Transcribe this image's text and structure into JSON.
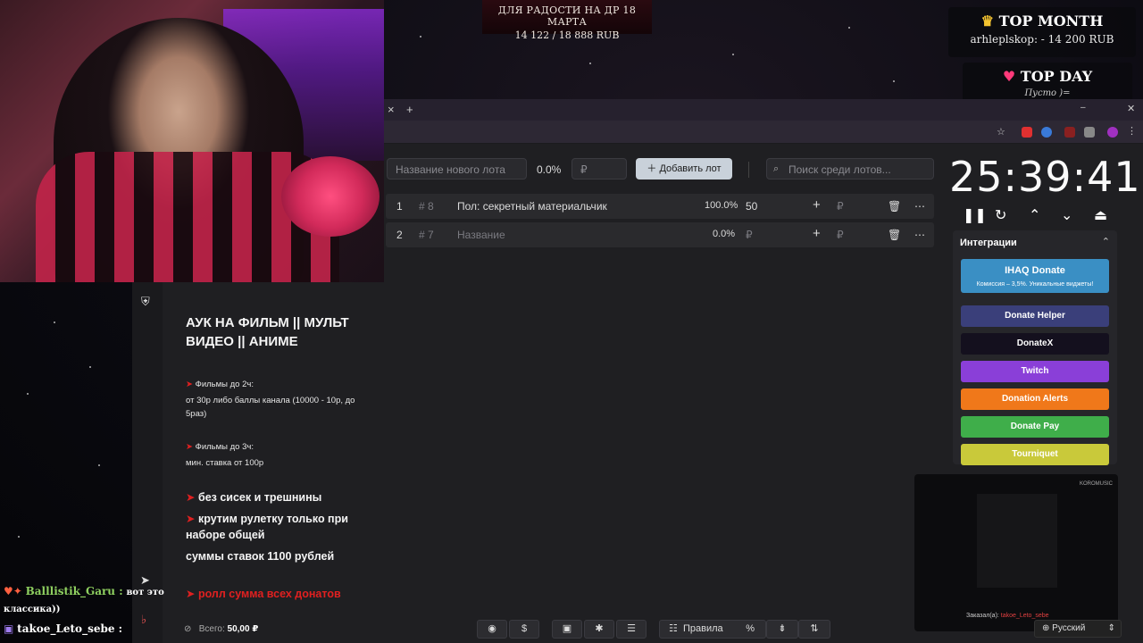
{
  "overlay": {
    "goal_line1": "ДЛЯ РАДОСТИ НА ДР 18 МАРТА",
    "goal_line2": "14 122 / 18 888 RUB",
    "top_month_title": "TOP MONTH",
    "top_month_value": "arhleplskop:  - 14 200 RUB",
    "top_day_title": "TOP DAY",
    "top_day_value": "Пусто )="
  },
  "browser": {
    "close_tab": "×",
    "new_tab": "+"
  },
  "lot_form": {
    "name_placeholder": "Название нового лота",
    "percent": "0.0%",
    "amount_placeholder": "₽",
    "add_label": "Добавить лот",
    "search_placeholder": "Поиск среди лотов..."
  },
  "lots": [
    {
      "index": "1",
      "id": "# 8",
      "name": "Пол: секретный материальчик",
      "percent": "100.0%",
      "amount": "50",
      "currency": "₽"
    },
    {
      "index": "2",
      "id": "# 7",
      "name": "Название",
      "percent": "0.0%",
      "amount": "₽",
      "currency": "₽"
    }
  ],
  "timer": "25:39:41",
  "integrations": {
    "title": "Интеграции",
    "items": [
      {
        "label": "IHAQ Donate",
        "sub": "Комиссия – 3,5%. Уникальные виджеты!",
        "color": "#3a8fc4"
      },
      {
        "label": "Donate Helper",
        "color": "#3a3f7a"
      },
      {
        "label": "DonateX",
        "color": "#14101e"
      },
      {
        "label": "Twitch",
        "color": "#8a3fd8"
      },
      {
        "label": "Donation Alerts",
        "color": "#f0781a"
      },
      {
        "label": "Donate Pay",
        "color": "#3fae4a"
      },
      {
        "label": "Tourniquet",
        "color": "#c9c93a"
      }
    ]
  },
  "description": {
    "title": "АУК НА ФИЛЬМ ||  МУЛЬТ ВИДЕО || АНИМЕ",
    "films2_title": "Фильмы до 2ч:",
    "films2_text": "от 30р либо баллы канала (10000 - 10р, до 5раз)",
    "films3_title": "Фильмы до 3ч:",
    "films3_text": "мин. ставка от 100р",
    "rule1": "без сисек и трешнины",
    "rule2": "крутим рулетку только при наборе общей",
    "rule3": "суммы ставок 1100 рублей",
    "rule4": "ролл сумма всех донатов",
    "total_label": "Всего:",
    "total_value": "50,00 ₽"
  },
  "chat": [
    {
      "nick": "Balllistik_Garu :",
      "text": "вот это",
      "text2": "классика))"
    },
    {
      "nick": "takoe_Leto_sebe :",
      "text": ""
    }
  ],
  "toolbar": {
    "rules": "Правила",
    "percent": "%",
    "language": "Русский"
  },
  "music": {
    "brand": "KOROMUSIC",
    "ordered": "Заказал(а):",
    "orderer": "takoe_Leto_sebe"
  }
}
